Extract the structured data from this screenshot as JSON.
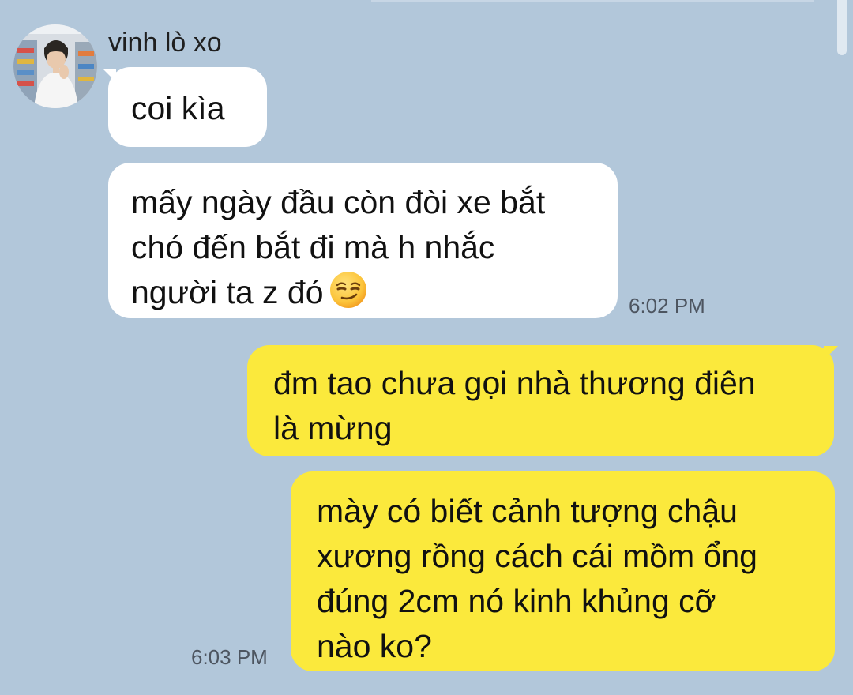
{
  "chat": {
    "sender": {
      "name": "vinh lò xo",
      "avatar_icon": "profile-photo-avatar"
    },
    "messages": [
      {
        "direction": "incoming",
        "lines": [
          "coi kìa"
        ]
      },
      {
        "direction": "incoming",
        "lines": [
          "mấy ngày đầu còn đòi xe bắt",
          "chó đến bắt đi mà h nhắc",
          "người ta z đó"
        ],
        "emoji_icon": "smirk-emoji-icon",
        "time": "6:02 PM"
      },
      {
        "direction": "outgoing",
        "lines": [
          "đm tao chưa gọi nhà thương điên",
          "là mừng"
        ]
      },
      {
        "direction": "outgoing",
        "lines": [
          "mày có biết cảnh tượng chậu",
          "xương rồng cách cái mồm ổng",
          "đúng 2cm nó kinh khủng cỡ",
          "nào ko?"
        ],
        "time": "6:03 PM"
      }
    ]
  },
  "colors": {
    "background": "#b2c7da",
    "incoming_bubble": "#ffffff",
    "outgoing_bubble": "#fbe93c",
    "text": "#111111",
    "timestamp": "#4d5560"
  }
}
